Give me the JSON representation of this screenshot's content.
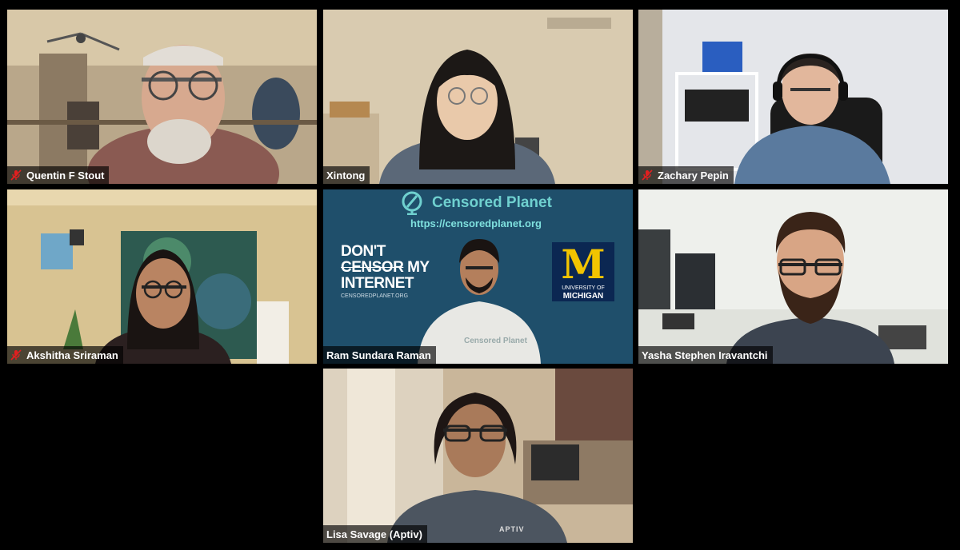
{
  "participants": [
    {
      "name": "Quentin F Stout",
      "muted": true
    },
    {
      "name": "Xintong",
      "muted": false
    },
    {
      "name": "Zachary Pepin",
      "muted": true
    },
    {
      "name": "Akshitha Sriraman",
      "muted": true
    },
    {
      "name": "Ram Sundara Raman",
      "muted": false
    },
    {
      "name": "Yasha Stephen Iravantchi",
      "muted": false
    },
    {
      "name": "Lisa Savage (Aptiv)",
      "muted": false
    }
  ],
  "background": {
    "title": "Censored Planet",
    "url": "https://censoredplanet.org",
    "slogan_line1": "DON'T",
    "slogan_censor": "CENSOR",
    "slogan_my": "MY",
    "slogan_line3": "INTERNET",
    "slogan_sub": "CENSOREDPLANET.ORG",
    "shirt_text": "Censored Planet",
    "university_letter": "M",
    "university_line1": "UNIVERSITY OF",
    "university_line2": "MICHIGAN"
  },
  "shirt_brand": "APTIV",
  "colors": {
    "accent_teal": "#6fd0cf",
    "michigan_maize": "#f2c400",
    "michigan_blue": "#0b2752",
    "mute_red": "#e02020"
  }
}
